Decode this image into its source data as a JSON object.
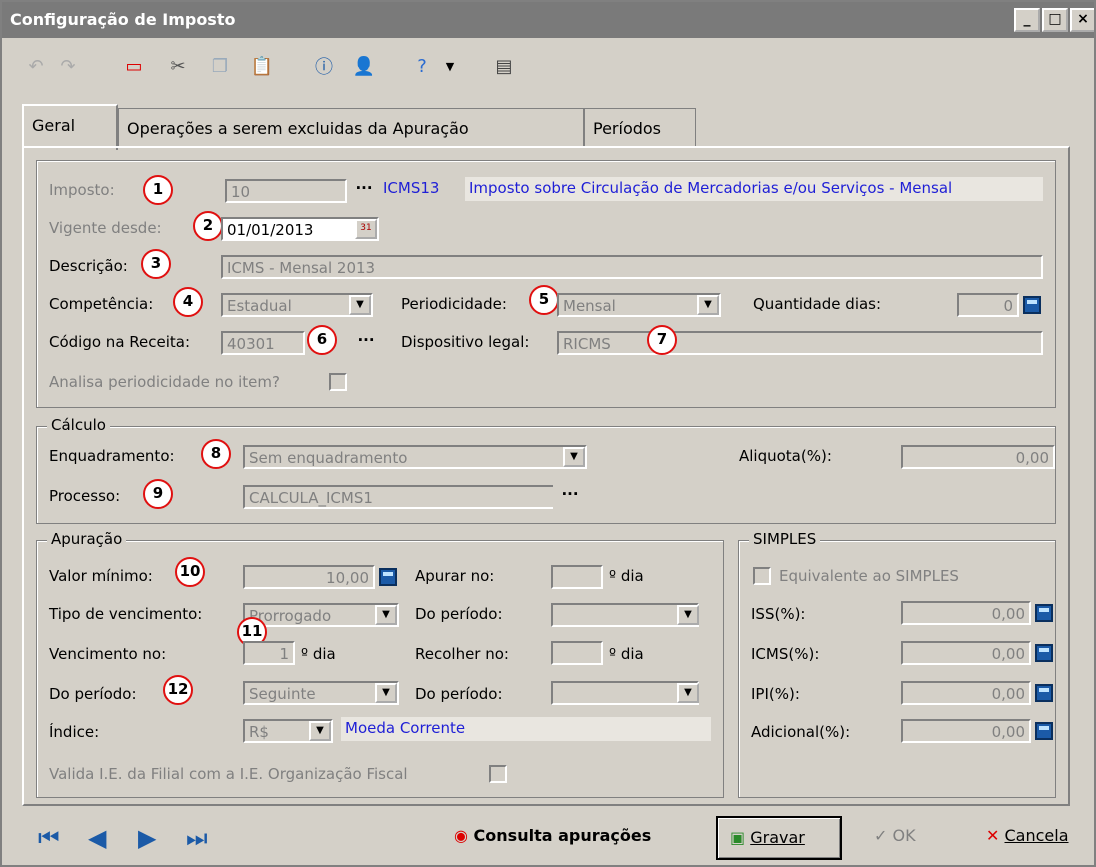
{
  "window": {
    "title": "Configuração de Imposto",
    "controls": [
      "_",
      "□",
      "×"
    ]
  },
  "tabs": [
    {
      "label": "Geral"
    },
    {
      "label": "Operações a serem excluidas da Apuração"
    },
    {
      "label": "Períodos"
    }
  ],
  "markers": [
    "1",
    "2",
    "3",
    "4",
    "5",
    "6",
    "7",
    "8",
    "9",
    "10",
    "11",
    "12"
  ],
  "geral": {
    "imposto_label": "Imposto:",
    "imposto_value": "10",
    "imposto_code": "ICMS13",
    "imposto_desc": "Imposto sobre Circulação de Mercadorias e/ou Serviços - Mensal",
    "vigente_label": "Vigente desde:",
    "vigente_value": "01/01/2013",
    "descricao_label": "Descrição:",
    "descricao_value": "ICMS - Mensal 2013",
    "competencia_label": "Competência:",
    "competencia_value": "Estadual",
    "periodicidade_label": "Periodicidade:",
    "periodicidade_value": "Mensal",
    "qtd_dias_label": "Quantidade dias:",
    "qtd_dias_value": "0",
    "codigo_label": "Código na Receita:",
    "codigo_value": "40301",
    "dispositivo_label": "Dispositivo legal:",
    "dispositivo_value": "RICMS",
    "analisa_label": "Analisa periodicidade no item?",
    "ellipsis": "···"
  },
  "calculo": {
    "title": "Cálculo",
    "enquadramento_label": "Enquadramento:",
    "enquadramento_value": "Sem enquadramento",
    "aliquota_label": "Aliquota(%):",
    "aliquota_value": "0,00",
    "processo_label": "Processo:",
    "processo_value": "CALCULA_ICMS1"
  },
  "apuracao": {
    "title": "Apuração",
    "valor_min_label": "Valor mínimo:",
    "valor_min_value": "10,00",
    "apurar_label": "Apurar no:",
    "dia_suffix": "º dia",
    "tipo_venc_label": "Tipo de vencimento:",
    "tipo_venc_value": "Prorrogado",
    "do_periodo_label": "Do período:",
    "venc_no_label": "Vencimento no:",
    "venc_no_value": "1",
    "recolher_label": "Recolher no:",
    "do_periodo2_value": "Seguinte",
    "indice_label": "Índice:",
    "indice_value": "R$",
    "indice_desc": "Moeda Corrente",
    "valida_label": "Valida I.E. da Filial com a I.E. Organização Fiscal"
  },
  "simples": {
    "title": "SIMPLES",
    "equivalente_label": "Equivalente ao SIMPLES",
    "iss_label": "ISS(%):",
    "iss_value": "0,00",
    "icms_label": "ICMS(%):",
    "icms_value": "0,00",
    "ipi_label": "IPI(%):",
    "ipi_value": "0,00",
    "adicional_label": "Adicional(%):",
    "adicional_value": "0,00"
  },
  "bottom": {
    "consulta_label": "Consulta apurações",
    "gravar_label": "Gravar",
    "ok_label": "OK",
    "cancela_label": "Cancela"
  }
}
